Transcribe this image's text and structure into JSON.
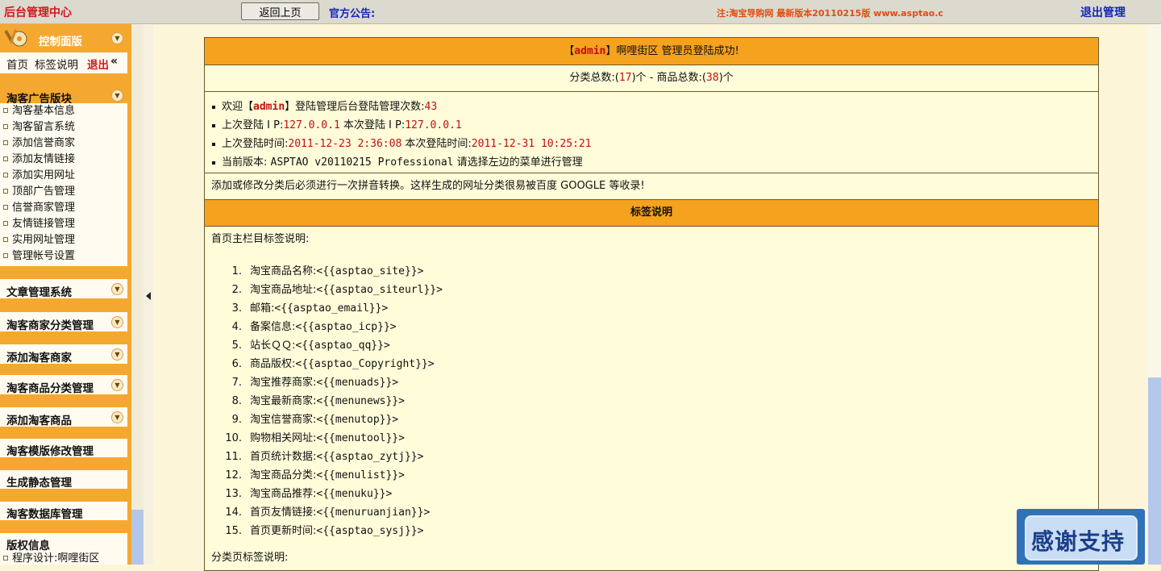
{
  "topbar": {
    "site_title": "后台管理中心",
    "back_button": "返回上页",
    "notice_label": "官方公告:",
    "notice_marquee": "注:淘宝导购网 最新版本20110215版 www.asptao.c",
    "logout": "退出管理"
  },
  "sidebar": {
    "control_panel": {
      "title": "控制面版",
      "links": [
        "首页",
        "标签说明",
        "退出"
      ],
      "collapse_glyph": "«"
    },
    "ad_section": {
      "title": "淘客广告版块",
      "items": [
        "淘客基本信息",
        "淘客留言系统",
        "添加信誉商家",
        "添加友情链接",
        "添加实用网址",
        "顶部广告管理",
        "信誉商家管理",
        "友情链接管理",
        "实用网址管理",
        "管理帐号设置"
      ]
    },
    "sections": [
      "文章管理系统",
      "淘客商家分类管理",
      "添加淘客商家",
      "淘客商品分类管理",
      "添加淘客商品"
    ],
    "plain_sections": [
      "淘客模版修改管理",
      "生成静态管理",
      "淘客数据库管理"
    ],
    "copyright": {
      "title": "版权信息",
      "line": "程序设计:啊哩街区"
    }
  },
  "main": {
    "login_banner": {
      "prefix": "【",
      "user": "admin",
      "suffix": "】啊哩街区 管理员登陆成功!"
    },
    "stats": {
      "label1": "分类总数:(",
      "categories": "17",
      "label2": ")个 - 商品总数:(",
      "products": "38",
      "label3": ")个"
    },
    "info": {
      "welcome_prefix": "欢迎【",
      "welcome_user": "admin",
      "welcome_suffix": "】登陆管理后台登陆管理次数:",
      "login_count": "43",
      "last_ip_label": "上次登陆 I P:",
      "last_ip": "127.0.0.1",
      "this_ip_label": " 本次登陆 I P:",
      "this_ip": "127.0.0.1",
      "last_time_label": "上次登陆时间:",
      "last_time": "2011-12-23 2:36:08",
      "this_time_label": " 本次登陆时间:",
      "this_time": "2011-12-31 10:25:21",
      "version_label": "当前版本: ",
      "version": "ASPTAO v20110215 Professional",
      "version_suffix": " 请选择左边的菜单进行管理"
    },
    "pinyin_notice": "添加或修改分类后必须进行一次拼音转换。这样生成的网址分类很易被百度 GOOGLE 等收录!",
    "tags_header": "标签说明",
    "tags_intro": "首页主栏目标签说明:",
    "tags": [
      {
        "n": "1.",
        "label": "淘宝商品名称:",
        "code": "<{{asptao_site}}>"
      },
      {
        "n": "2.",
        "label": "淘宝商品地址:",
        "code": "<{{asptao_siteurl}}>"
      },
      {
        "n": "3.",
        "label": "邮箱:",
        "code": "<{{asptao_email}}>"
      },
      {
        "n": "4.",
        "label": "备案信息:",
        "code": "<{{asptao_icp}}>"
      },
      {
        "n": "5.",
        "label": "站长ＱＱ:",
        "code": "<{{asptao_qq}}>"
      },
      {
        "n": "6.",
        "label": "商品版权:",
        "code": "<{{asptao_Copyright}}>"
      },
      {
        "n": "7.",
        "label": "淘宝推荐商家:",
        "code": "<{{menuads}}>"
      },
      {
        "n": "8.",
        "label": "淘宝最新商家:",
        "code": "<{{menunews}}>"
      },
      {
        "n": "9.",
        "label": "淘宝信誉商家:",
        "code": "<{{menutop}}>"
      },
      {
        "n": "10.",
        "label": "购物相关网址:",
        "code": "<{{menutool}}>"
      },
      {
        "n": "11.",
        "label": "首页统计数据:",
        "code": "<{{asptao_zytj}}>"
      },
      {
        "n": "12.",
        "label": "淘宝商品分类:",
        "code": "<{{menulist}}>"
      },
      {
        "n": "13.",
        "label": "淘宝商品推荐:",
        "code": "<{{menuku}}>"
      },
      {
        "n": "14.",
        "label": "首页友情链接:",
        "code": "<{{menuruanjian}}>"
      },
      {
        "n": "15.",
        "label": "首页更新时间:",
        "code": "<{{asptao_sysj}}>"
      }
    ],
    "tags_intro2": "分类页标签说明:"
  },
  "thanks_badge": "感谢支持",
  "colors": {
    "accent": "#f5a21e",
    "title_red": "#d0181c",
    "link_blue": "#1028b8",
    "panel_bg": "#fffcda"
  }
}
